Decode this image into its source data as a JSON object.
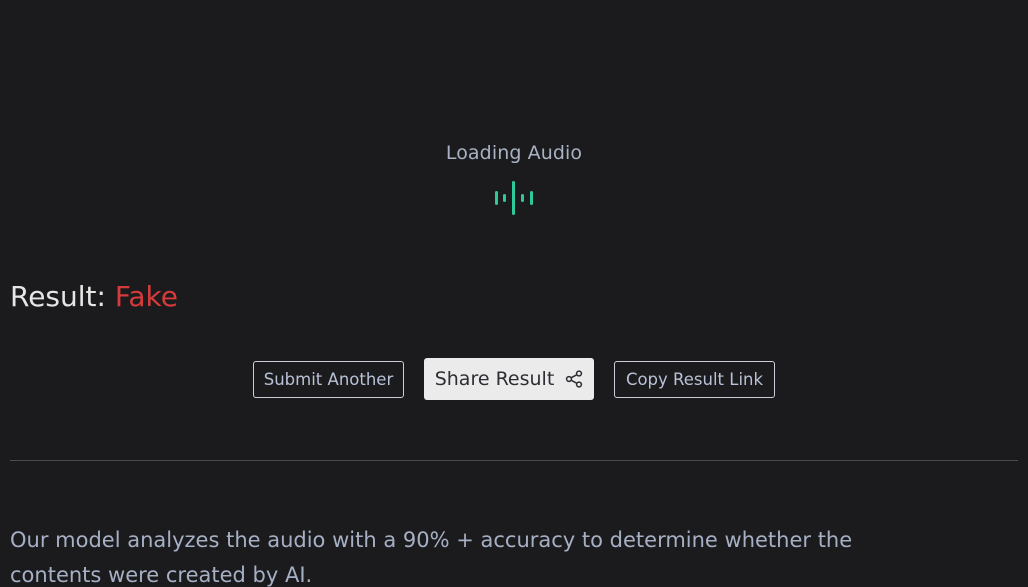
{
  "loading": {
    "label": "Loading Audio",
    "icon": "audio-wave-icon",
    "accent_color": "#2ec99a"
  },
  "result": {
    "label": "Result:",
    "value": "Fake",
    "value_color": "#d63a3a"
  },
  "buttons": {
    "submit_another": "Submit Another",
    "share_result": "Share Result",
    "share_icon": "share-icon",
    "copy_result_link": "Copy Result Link"
  },
  "description": "Our model analyzes the audio with a 90% + accuracy to determine whether the contents were created by AI."
}
